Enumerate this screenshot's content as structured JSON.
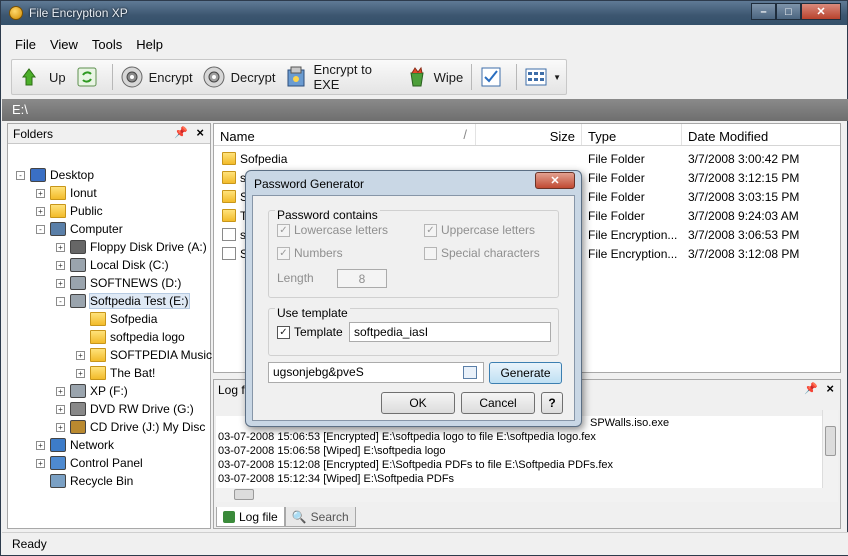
{
  "window": {
    "title": "File Encryption XP",
    "minimize": "–",
    "maximize": "□",
    "close": "✕"
  },
  "menu": [
    "File",
    "View",
    "Tools",
    "Help"
  ],
  "toolbar": {
    "up": "Up",
    "encrypt": "Encrypt",
    "decrypt": "Decrypt",
    "encrypt_exe": "Encrypt to EXE",
    "wipe": "Wipe"
  },
  "path": "E:\\",
  "folders_panel": {
    "title": "Folders",
    "tree": [
      {
        "label": "Desktop",
        "exp": "-",
        "icon": "desktop"
      },
      {
        "label": "Ionut",
        "exp": "+",
        "icon": "folder"
      },
      {
        "label": "Public",
        "exp": "+",
        "icon": "folder"
      },
      {
        "label": "Computer",
        "exp": "-",
        "icon": "computer"
      },
      {
        "label": "Floppy Disk Drive (A:)",
        "exp": "+",
        "icon": "floppy"
      },
      {
        "label": "Local Disk (C:)",
        "exp": "+",
        "icon": "drive"
      },
      {
        "label": "SOFTNEWS (D:)",
        "exp": "+",
        "icon": "drive"
      },
      {
        "label": "Softpedia Test (E:)",
        "exp": "-",
        "icon": "drive"
      },
      {
        "label": "Sofpedia",
        "exp": "",
        "icon": "folder"
      },
      {
        "label": "softpedia logo",
        "exp": "",
        "icon": "folder"
      },
      {
        "label": "SOFTPEDIA Music",
        "exp": "+",
        "icon": "folder"
      },
      {
        "label": "The Bat!",
        "exp": "+",
        "icon": "folder"
      },
      {
        "label": "XP (F:)",
        "exp": "+",
        "icon": "drive"
      },
      {
        "label": "DVD RW Drive (G:)",
        "exp": "+",
        "icon": "dvd"
      },
      {
        "label": "CD Drive (J:) My Disc",
        "exp": "+",
        "icon": "cd"
      },
      {
        "label": "Network",
        "exp": "+",
        "icon": "network"
      },
      {
        "label": "Control Panel",
        "exp": "+",
        "icon": "control"
      },
      {
        "label": "Recycle Bin",
        "exp": "",
        "icon": "recycle"
      }
    ]
  },
  "file_list": {
    "columns": [
      "Name",
      "Size",
      "Type",
      "Date Modified"
    ],
    "rows": [
      {
        "name": "Sofpedia",
        "size": "",
        "type": "File Folder",
        "date": "3/7/2008 3:00:42 PM",
        "icon": "folder"
      },
      {
        "name": "so",
        "size": "",
        "type": "File Folder",
        "date": "3/7/2008 3:12:15 PM",
        "icon": "folder"
      },
      {
        "name": "So",
        "size": "",
        "type": "File Folder",
        "date": "3/7/2008 3:03:15 PM",
        "icon": "folder"
      },
      {
        "name": "T",
        "size": "",
        "type": "File Folder",
        "date": "3/7/2008 9:24:03 AM",
        "icon": "folder"
      },
      {
        "name": "so",
        "size": "",
        "type": "File Encryption...",
        "date": "3/7/2008 3:06:53 PM",
        "icon": "file"
      },
      {
        "name": "So",
        "size": "",
        "type": "File Encryption...",
        "date": "3/7/2008 3:12:08 PM",
        "icon": "file"
      }
    ]
  },
  "log_panel": {
    "title": "Log fi",
    "lines": [
      "SPWalls.iso.exe",
      "03-07-2008 15:06:53 [Encrypted] E:\\softpedia logo to file E:\\softpedia logo.fex",
      "03-07-2008 15:06:58 [Wiped] E:\\softpedia logo",
      "03-07-2008 15:12:08 [Encrypted] E:\\Softpedia PDFs to file E:\\Softpedia PDFs.fex",
      "03-07-2008 15:12:34 [Wiped] E:\\Softpedia PDFs"
    ],
    "tabs": [
      "Log file",
      "Search"
    ]
  },
  "status": "Ready",
  "dialog": {
    "title": "Password Generator",
    "group_contains": "Password contains",
    "lowercase": "Lowercase letters",
    "uppercase": "Uppercase letters",
    "numbers": "Numbers",
    "special": "Special characters",
    "length_label": "Length",
    "length_value": "8",
    "group_template": "Use template",
    "template_label": "Template",
    "template_value": "softpedia_iasI",
    "generated": "ugsonjebg&pveS",
    "generate_btn": "Generate",
    "ok_btn": "OK",
    "cancel_btn": "Cancel",
    "help_btn": "?"
  }
}
